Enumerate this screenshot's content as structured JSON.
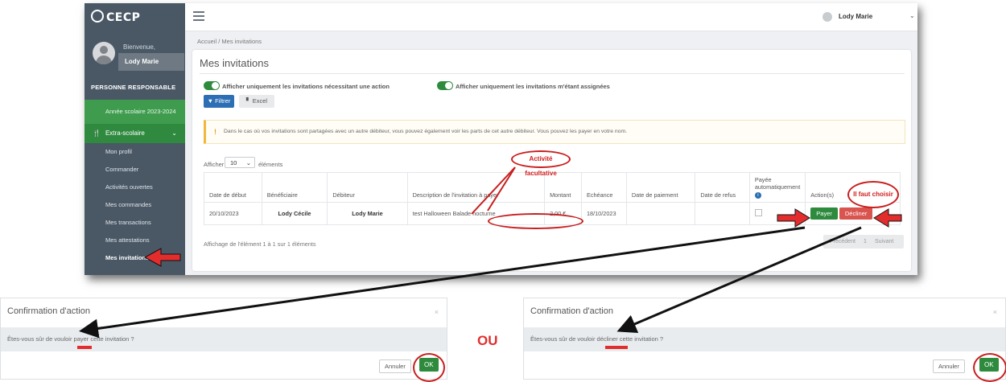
{
  "app": {
    "logo_text": "CECP",
    "welcome": "Bienvenue,",
    "user_name": "Lody Marie"
  },
  "sidebar": {
    "section_title": "PERSONNE RESPONSABLE",
    "year": "Année scolaire 2023-2024",
    "group": "Extra-scolaire",
    "items": [
      "Mon profil",
      "Commander",
      "Activités ouvertes",
      "Mes commandes",
      "Mes transactions",
      "Mes attestations",
      "Mes invitations"
    ]
  },
  "header": {
    "breadcrumb": "Accueil  /  Mes invitations",
    "user_name": "Lody Marie"
  },
  "page": {
    "title": "Mes invitations",
    "toggle1": "Afficher uniquement les invitations nécessitant une action",
    "toggle2": "Afficher uniquement les invitations m'étant assignées",
    "filter_btn": "Filtrer",
    "excel_btn": "Excel",
    "alert": "Dans le cas où vos invitations sont partagées avec un autre débiteur, vous pouvez également voir les parts de cet autre débiteur. Vous pouvez les payer en votre nom.",
    "show_label": "Afficher",
    "show_value": "10",
    "show_suffix": "éléments",
    "columns": [
      "Date de début",
      "Bénéficiaire",
      "Débiteur",
      "Description de l'invitation à payer",
      "Montant",
      "Echéance",
      "Date de paiement",
      "Date de refus",
      "Payée automatiquement",
      "Action(s)"
    ],
    "row": {
      "date_debut": "20/10/2023",
      "beneficiaire": "Lody Cécile",
      "debiteur": "Lody Marie",
      "description": "test Halloween Balade nocturne",
      "montant": "2,00 €",
      "echeance": "18/10/2023",
      "date_paiement": "",
      "date_refus": ""
    },
    "pay_btn": "Payer",
    "decline_btn": "Décliner",
    "footer_info": "Affichage de l'élément 1 à 1 sur 1 éléments",
    "pager_prev": "Précédent",
    "pager_page": "1",
    "pager_next": "Suivant"
  },
  "annotations": {
    "activity": "Activité facultative",
    "must_choose": "Il faut choisir",
    "or": "OU"
  },
  "dialog_pay": {
    "title": "Confirmation d'action",
    "close": "×",
    "question": "Êtes-vous sûr de vouloir payer cette invitation ?",
    "cancel": "Annuler",
    "ok": "OK"
  },
  "dialog_decline": {
    "title": "Confirmation d'action",
    "close": "×",
    "question": "Êtes-vous sûr de vouloir décliner cette invitation ?",
    "cancel": "Annuler",
    "ok": "OK"
  },
  "colors": {
    "sidebar": "#4a5866",
    "green": "#2e8b3d",
    "red": "#d9534f",
    "blue": "#2c6fb5",
    "annotation_red": "#c81e1e"
  }
}
